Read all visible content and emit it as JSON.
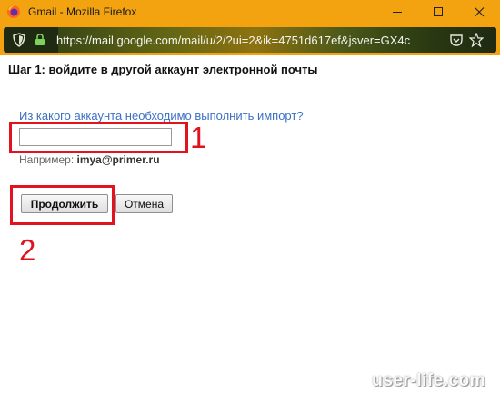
{
  "window": {
    "title": "Gmail - Mozilla Firefox",
    "controls": {
      "minimize": "minimize-icon",
      "maximize": "maximize-icon",
      "close": "close-icon"
    }
  },
  "url_bar": {
    "url": "https://mail.google.com/mail/u/2/?ui=2&ik=4751d617ef&jsver=GX4c",
    "icons": [
      "shield-icon",
      "lock-icon",
      "pocket-icon",
      "bookmark-star-icon"
    ]
  },
  "dialog": {
    "step_title": "Шаг 1: войдите в другой аккаунт электронной почты",
    "question": "Из какого аккаунта необходимо выполнить импорт?",
    "email_input": {
      "value": "",
      "placeholder": ""
    },
    "hint_prefix": "Например: ",
    "hint_example": "imya@primer.ru",
    "continue_label": "Продолжить",
    "cancel_label": "Отмена"
  },
  "annotations": {
    "marker_1": "1",
    "marker_2": "2",
    "color": "#e0131e"
  },
  "watermark": "user-life.com",
  "colors": {
    "titlebar": "#f2a30f",
    "link": "#3b6fc4",
    "highlight": "#e0131e"
  }
}
